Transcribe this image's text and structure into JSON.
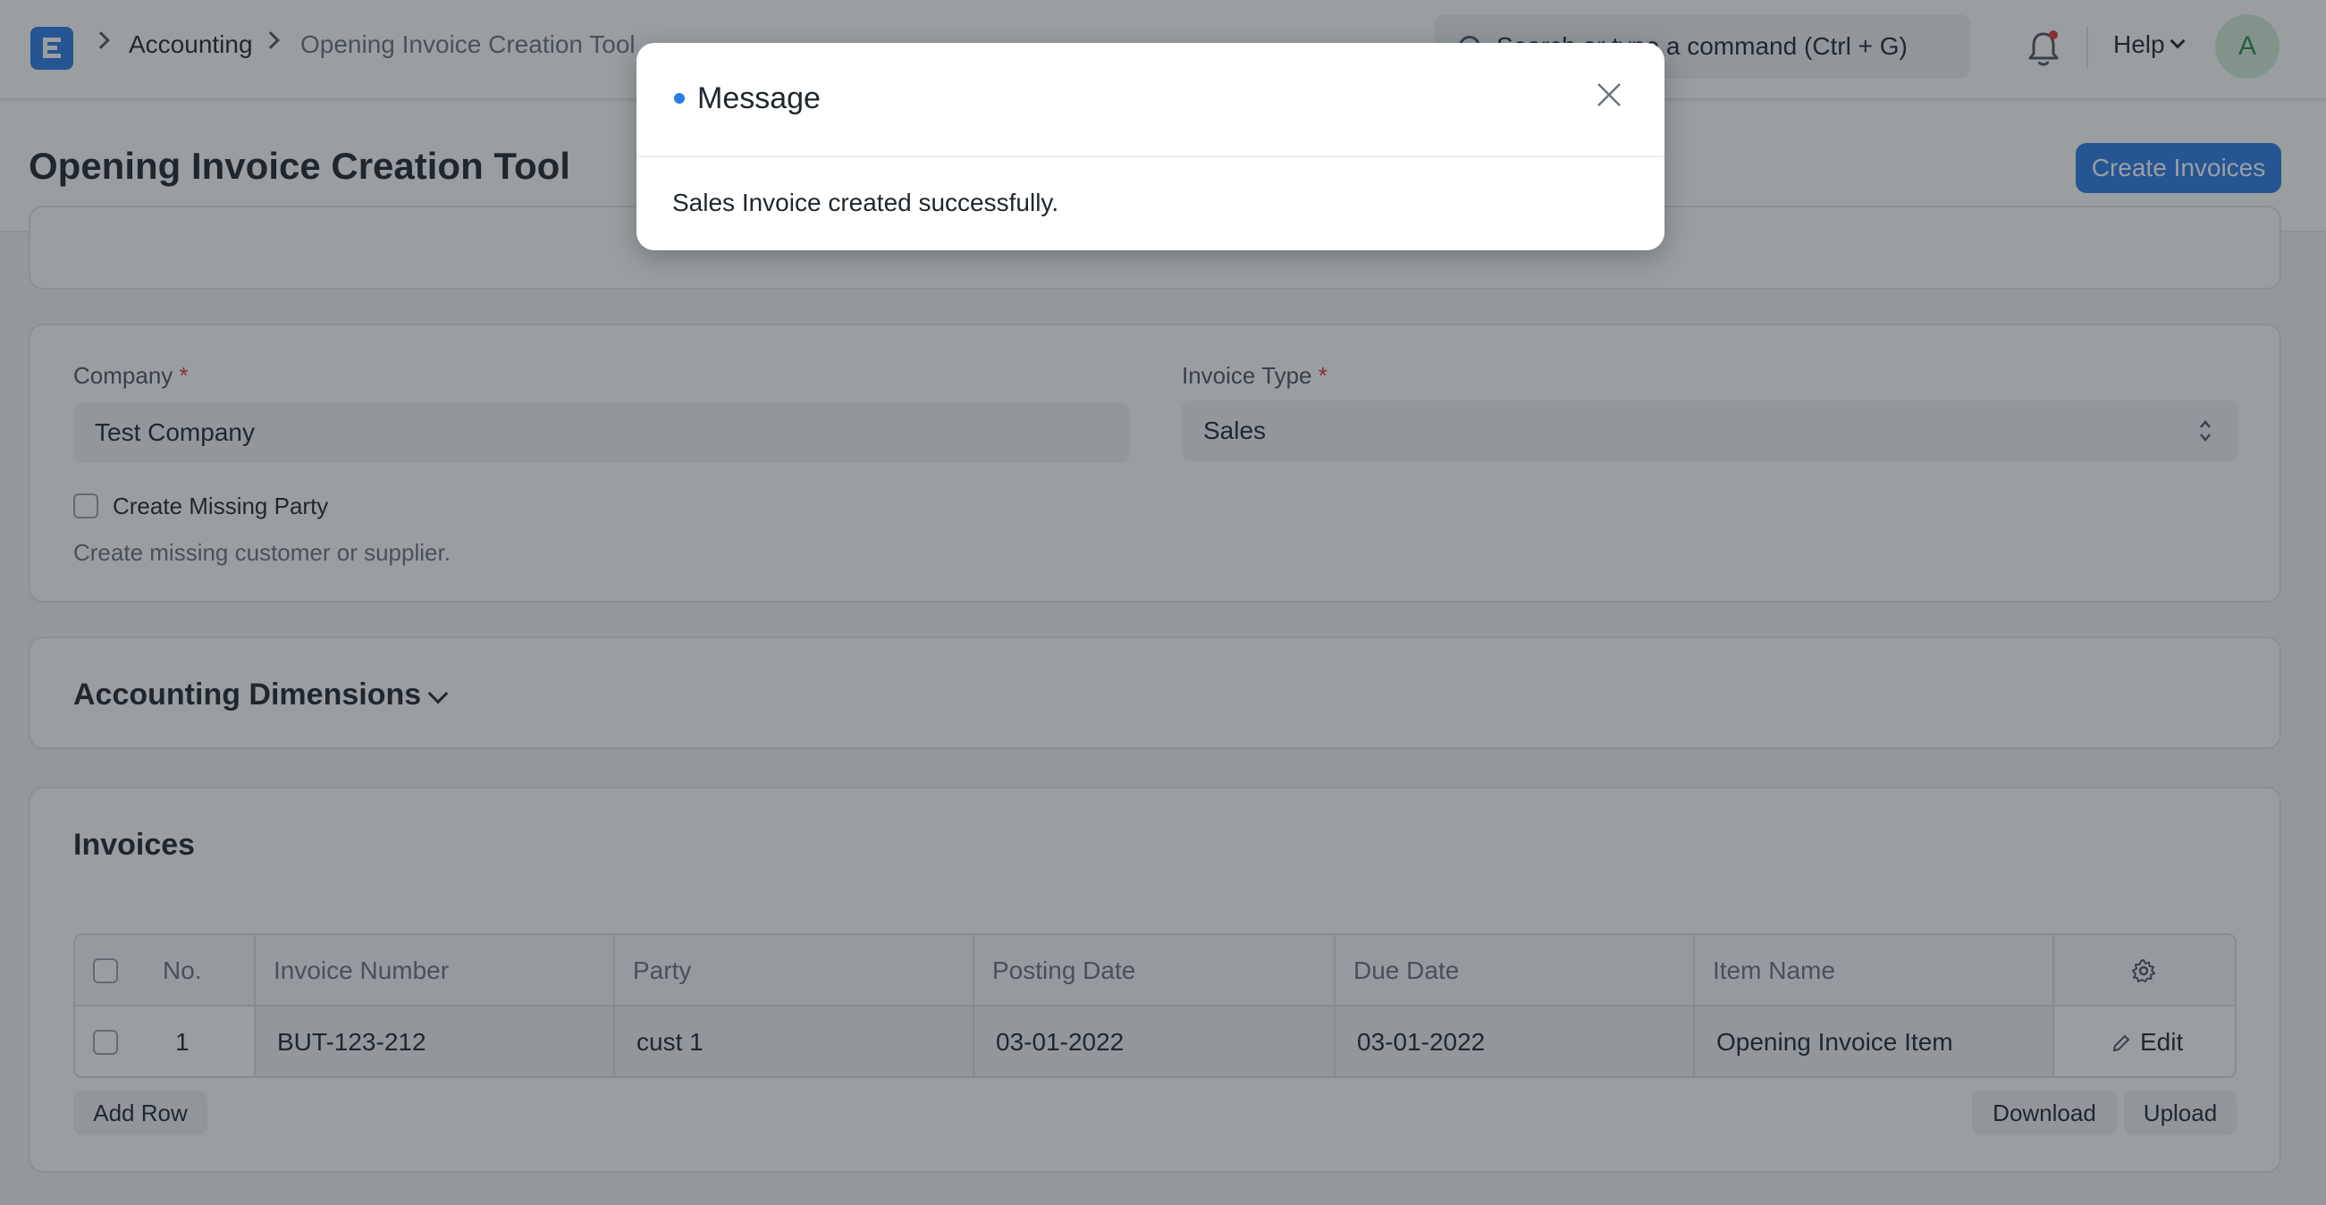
{
  "navbar": {
    "breadcrumbs": [
      "Accounting",
      "Opening Invoice Creation Tool"
    ],
    "search_placeholder": "Search or type a command (Ctrl + G)",
    "help_label": "Help",
    "avatar_initial": "A"
  },
  "page": {
    "title": "Opening Invoice Creation Tool",
    "primary_action": "Create Invoices"
  },
  "form": {
    "company_label": "Company",
    "company_value": "Test Company",
    "invoice_type_label": "Invoice Type",
    "invoice_type_value": "Sales",
    "required_mark": "*",
    "create_missing_party_label": "Create Missing Party",
    "create_missing_party_desc": "Create missing customer or supplier."
  },
  "sections": {
    "accounting_dimensions": "Accounting Dimensions",
    "invoices": "Invoices"
  },
  "grid": {
    "columns": [
      "No.",
      "Invoice Number",
      "Party",
      "Posting Date",
      "Due Date",
      "Item Name"
    ],
    "rows": [
      {
        "no": "1",
        "invoice_number": "BUT-123-212",
        "party": "cust 1",
        "posting_date": "03-01-2022",
        "due_date": "03-01-2022",
        "item_name": "Opening Invoice Item",
        "edit_label": "Edit"
      }
    ],
    "add_row_label": "Add Row",
    "download_label": "Download",
    "upload_label": "Upload"
  },
  "modal": {
    "title": "Message",
    "body": "Sales Invoice created successfully."
  },
  "colors": {
    "primary": "#2b7be5",
    "required": "#e03636",
    "overlay": "rgba(31,39,46,0.45)"
  }
}
